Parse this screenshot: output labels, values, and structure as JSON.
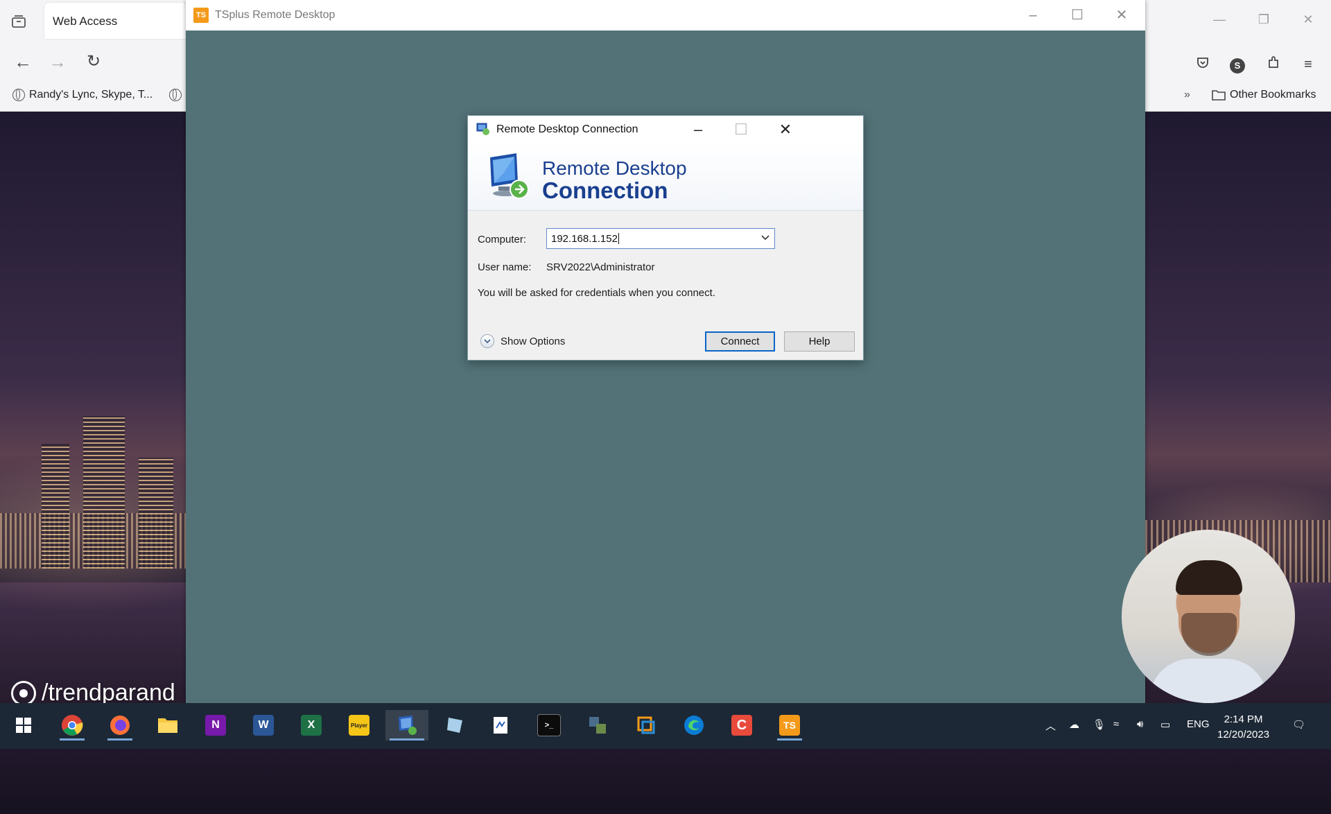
{
  "browser": {
    "tab_title": "Web Access",
    "bookmarks": [
      {
        "label": "Randy's Lync, Skype, T..."
      }
    ],
    "other_bookmarks": "Other Bookmarks",
    "profile_initial": "S"
  },
  "ts_window": {
    "title": "TSplus Remote Desktop",
    "logo_text": "TS"
  },
  "rdc": {
    "title": "Remote Desktop Connection",
    "banner_line1": "Remote Desktop",
    "banner_line2": "Connection",
    "computer_label": "Computer:",
    "computer_value": "192.168.1.152",
    "username_label": "User name:",
    "username_value": "SRV2022\\Administrator",
    "info_text": "You will be asked for credentials when you connect.",
    "show_options": "Show Options",
    "connect": "Connect",
    "help": "Help"
  },
  "watermark": "/trendparand",
  "taskbar": {
    "apps": [
      {
        "name": "chrome",
        "label": ""
      },
      {
        "name": "firefox",
        "label": ""
      },
      {
        "name": "file-explorer",
        "label": ""
      },
      {
        "name": "onenote",
        "label": "N"
      },
      {
        "name": "word",
        "label": "W"
      },
      {
        "name": "excel",
        "label": "X"
      },
      {
        "name": "player",
        "label": "Player"
      },
      {
        "name": "remote-desktop",
        "label": ""
      },
      {
        "name": "app-blue",
        "label": ""
      },
      {
        "name": "app-doc",
        "label": ""
      },
      {
        "name": "terminal",
        "label": ">_"
      },
      {
        "name": "app-network",
        "label": ""
      },
      {
        "name": "app-orange",
        "label": ""
      },
      {
        "name": "edge",
        "label": ""
      },
      {
        "name": "app-red",
        "label": "C"
      },
      {
        "name": "tsplus",
        "label": "TS"
      }
    ],
    "lang": "ENG",
    "time": "2:14 PM",
    "date": "12/20/2023"
  },
  "colors": {
    "ts_background": "#527277",
    "rdc_accent": "#1a3f8f",
    "taskbar": "#1c2836"
  }
}
